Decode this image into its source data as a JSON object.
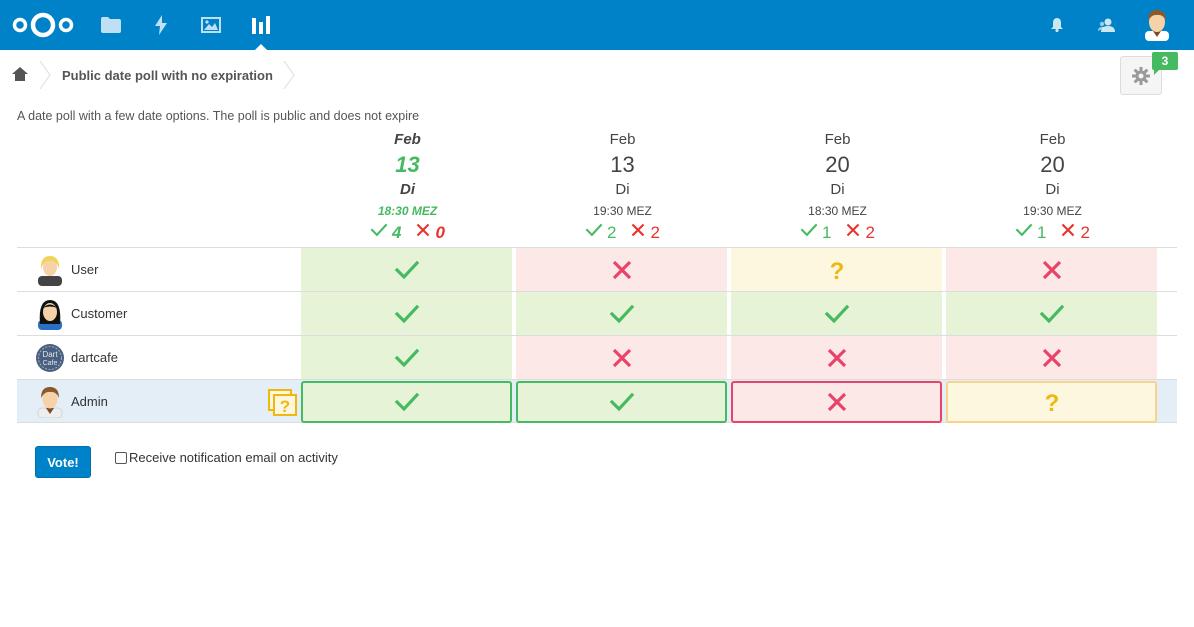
{
  "header": {
    "apps": [
      "files-icon",
      "activity-icon",
      "gallery-icon",
      "polls-icon"
    ],
    "right": [
      "notifications-icon",
      "contacts-icon"
    ]
  },
  "breadcrumb": {
    "title": "Public date poll with no expiration"
  },
  "settings": {
    "badge_count": "3"
  },
  "poll": {
    "description": "A date poll with a few date options. The poll is public and does not expire",
    "options": [
      {
        "month": "Feb",
        "day": "13",
        "dow": "Di",
        "time": "18:30 MEZ",
        "yes": "4",
        "no": "0",
        "best": true
      },
      {
        "month": "Feb",
        "day": "13",
        "dow": "Di",
        "time": "19:30 MEZ",
        "yes": "2",
        "no": "2",
        "best": false
      },
      {
        "month": "Feb",
        "day": "20",
        "dow": "Di",
        "time": "18:30 MEZ",
        "yes": "1",
        "no": "2",
        "best": false
      },
      {
        "month": "Feb",
        "day": "20",
        "dow": "Di",
        "time": "19:30 MEZ",
        "yes": "1",
        "no": "2",
        "best": false
      }
    ],
    "participants": [
      {
        "name": "User",
        "avatar": "blonde-user-avatar",
        "votes": [
          "yes",
          "no",
          "maybe",
          "no"
        ],
        "current": false
      },
      {
        "name": "Customer",
        "avatar": "female-user-avatar",
        "votes": [
          "yes",
          "yes",
          "yes",
          "yes"
        ],
        "current": false
      },
      {
        "name": "dartcafe",
        "avatar": "dartcafe-logo-avatar",
        "votes": [
          "yes",
          "no",
          "no",
          "no"
        ],
        "current": false
      },
      {
        "name": "Admin",
        "avatar": "admin-user-avatar",
        "votes": [
          "yes",
          "yes",
          "no",
          "maybe"
        ],
        "current": true
      }
    ]
  },
  "footer": {
    "vote_label": "Vote!",
    "notify_label": "Receive notification email on activity"
  },
  "colors": {
    "brand": "#0082c9",
    "yes": "#46ba61",
    "no": "#e9322d",
    "maybe": "#f0b70f"
  }
}
